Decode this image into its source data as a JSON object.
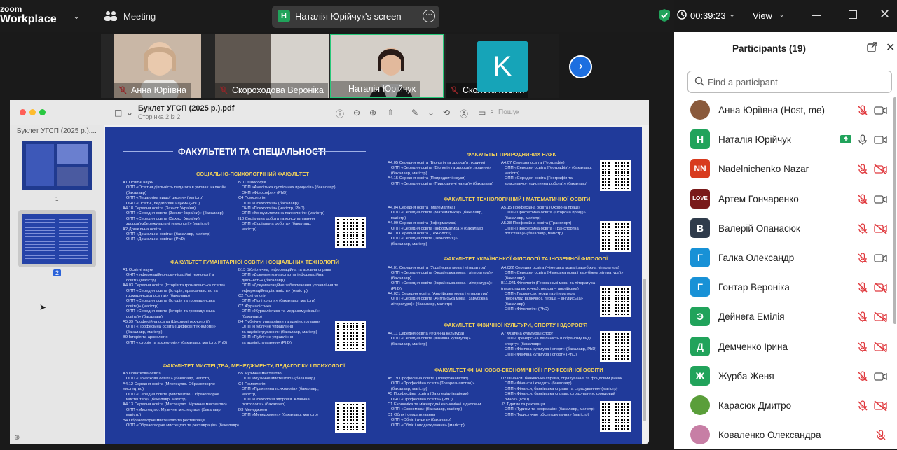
{
  "topbar": {
    "brand_line1": "zoom",
    "brand_line2": "Workplace",
    "meeting_label": "Meeting",
    "screen_badge": "Н",
    "screen_label": "Наталія Юрійчук's screen",
    "timer": "00:39:23",
    "view_label": "View"
  },
  "gallery": {
    "tiles": [
      {
        "name": "Анна Юріївна"
      },
      {
        "name": "Скороходова Вероніка"
      },
      {
        "name": "Наталія Юрійчук"
      },
      {
        "name": "Сколота Ксенія",
        "avatar_letter": "K"
      }
    ]
  },
  "pdf": {
    "title": "Буклет УГСП (2025 р.).pdf",
    "subtitle": "Сторінка 2 із 2",
    "search_placeholder": "Пошук",
    "sidebar_title": "Буклет УГСП (2025 р.)....",
    "thumb_labels": [
      "1",
      "2"
    ],
    "page": {
      "heading": "ФАКУЛЬТЕТИ ТА СПЕЦІАЛЬНОСТІ",
      "left": [
        {
          "title": "СОЦІАЛЬНО-ПСИХОЛОГІЧНИЙ ФАКУЛЬТЕТ",
          "col1": "A1 Освітні науки\n   ОПП «Освітня діяльність педагога в умовах інклюзії»\n   (бакалавр)\n   ОПП «Педагогіка вищої школи» (магістр)\n   ОНП «Освітні, педагогічні науки» (PhD)\nA4.18 Середня освіта (Захист України)\n   ОПП «Середня освіта (Захист України)» (бакалавр)\n   ОПП «Середня освіта (Захист України),\n   здоров'язбережувальні технології» (магістр)\nA2 Дошкільна освіта\n   ОПП «Дошкільна освіта» (бакалавр, магістр)\n   ОНП «Дошкільна освіта» (PhD)",
          "col2": "B10 Філософія\n   ОПП «Аналітика суспільних процесів» (бакалавр)\n   ОНП «Філософія» (PhD)\nC4 Психологія\n   ОПП «Психологія» (бакалавр)\n   ОНП «Психологія» (магістр, PhD)\n   ОПП «Консультативна психологія» (магістр)\nI10 Соціальна робота та консультування\n   ОПП «Соціальна робота» (бакалавр,\n   магістр)"
        },
        {
          "title": "ФАКУЛЬТЕТ ГУМАНІТАРНОЇ ОСВІТИ І СОЦІАЛЬНИХ ТЕХНОЛОГІЙ",
          "col1": "A1 Освітні науки\n   ОНП «Інформаційно-комунікаційні технології в\n   освіті» (магістр)\nA4.03 Середня освіта (Історія та громадянська освіта)\n   ОПП «Середня освіта (Історія, правознавство та\n   громадянська освіта)» (бакалавр)\n   ОПП «Середня освіта (Історія та громадянська\n   освіта)» (магістр)\n   ОПП «Середня освіта (Історія та громадянська\n   освіта)» (бакалавр)\nA5.39 Професійна освіта (Цифрові технології)\n   ОПП «Професійна освіта (Цифрові технології)»\n   (бакалавр, магістр)\nB9 Історія та археологія\n   ОПП «Історія та археологія» (бакалавр, магістр, PhD)",
          "col2": "B13 Бібліотечна, інформаційна та архівна справа\n   ОПП «Документознавство та інформаційна\n   діяльність» (бакалавр)\n   ОПП «Документаційне забезпечення управління та\n   інформаційна діяльність» (магістр)\nC2 Політологія\n   ОПП «Політологія» (бакалавр, магістр)\nC7 Журналістика\n   ОПП «Журналістика та медіакомунікації»\n   (бакалавр)\nD4 Публічне управління та адміністрування\n   ОПП «Публічне управління\n   та адміністрування» (бакалавр, магістр)\n   ОНП «Публічне управління\n   та адміністрування» (PhD)"
        },
        {
          "title": "ФАКУЛЬТЕТ МИСТЕЦТВА, МЕНЕДЖМЕНТУ, ПЕДАГОГІКИ І ПСИХОЛОГІЇ",
          "col1": "A3 Початкова освіта\n   ОПП «Початкова освіта» (бакалавр, магістр)\nA4.12 Середня освіта (Мистецтво. Образотворче\nмистецтво)\n   ОПП «Середня освіта (Мистецтво. Образотворче\n   мистецтво)» (бакалавр, магістр)\nA4.13 Середня освіта (Мистецтво. Музичне мистецтво)\n   ОПП «Мистецтво. Музичне мистецтво» (бакалавр,\n   магістр)\nB4 Образотворче мистецтво та реставрація\n   ОПП «Образотворче мистецтво та реставрація» (бакалавр)",
          "col2": "B5 Музичне мистецтво\n   ОПП «Музичне мистецтво» (бакалавр)\nC4 Психологія\n   ОПП «Практична психологія» (бакалавр,\n   магістр)\n   ОПП «Психологія здоров'я. Клінічна\n   психологія» (бакалавр)\nD3 Менеджмент\n   ОПП «Менеджмент» (бакалавр, магістр)"
        }
      ],
      "right": [
        {
          "title": "ФАКУЛЬТЕТ ПРИРОДНИЧИХ НАУК",
          "col1": "A4.05 Середня освіта (Біологія та здоров'я людини)\n   ОПП «Середня освіта (Біологія та здоров'я людини)»\n   (бакалавр, магістр)\nA4.15 Середня освіта (Природничі науки)\n   ОПП «Середня освіта (Природничі науки)» (бакалавр)",
          "col2": "A4.07 Середня освіта (Географія)\n   ОПП «Середня освіта (Географія)» (бакалавр,\n   магістр)\n   ОПП «Середня освіта (Географія та\n   краєзнавчо-туристична робота)» (бакалавр)"
        },
        {
          "title": "ФАКУЛЬТЕТ ТЕХНОЛОГІЧНИЙ І МАТЕМАТИЧНОЇ ОСВІТИ",
          "col1": "A4.04 Середня освіта (Математика)\n   ОПП «Середня освіта (Математика)» (бакалавр,\n   магістр)\nA4.09 Середня освіта (Інформатика)\n   ОПП «Середня освіта (Інформатика)» (бакалавр)\nA4.10 Середня освіта (Технології)\n   ОПП «Середня освіта (Технології)»\n   (бакалавр, магістр)",
          "col2": "A5.15 Професійна освіта (Охорона праці)\n   ОПП «Професійна освіта (Охорона праці)»\n   (бакалавр, магістр)\nA5.38 Професійна освіта (Транспорт)\n   ОПП «Професійна освіта (Транспортна\n   логістика)» (бакалавр, магістр)"
        },
        {
          "title": "ФАКУЛЬТЕТ УКРАЇНСЬКОЇ ФІЛОЛОГІЇ ТА ІНОЗЕМНОЇ ФІЛОЛОГІЇ",
          "col1": "A4.01 Середня освіта (Українська мова і література)\n   ОПП «Середня освіта (Українська мова і література)»\n   (бакалавр)\n   ОПП «Середня освіта (Українська мова і література)»\n   (PhD)\nA4.021 Середня освіта (Англійська мова і література)\n   ОПП «Середня освіта (Англійська мова і зарубіжна\n   література)» (бакалавр, магістр)",
          "col2": "A4.022 Середня освіта (Німецька мова і зарубіжна література)\n   ОПП «Середня освіта (Німецька мова і зарубіжна література)»\n   (бакалавр)\nB11.041 Філологія (Германські мови та література\n(переклад включно), перша – англійська)\n   ОПП «Германські мови та література\n   (переклад включно), перша – англійська»\n   (бакалавр)\n   ОНП «Філологія» (PhD)"
        },
        {
          "title": "ФАКУЛЬТЕТ ФІЗИЧНОЇ КУЛЬТУРИ, СПОРТУ І ЗДОРОВ'Я",
          "col1": "A4.11 Середня освіта (Фізична культура)\n   ОПП «Середня освіта (Фізична культура)»\n   (бакалавр, магістр)",
          "col2": "A7 Фізична культура і спорт\n   ОПП «Тренерська діяльність в обраному виді\n   спорту» (бакалавр)\n   ОПП «Фізична культура і спорт» (бакалавр, PhD)\n   ОПП «Фізична культура і спорт» (PhD)"
        },
        {
          "title": "ФАКУЛЬТЕТ ФІНАНСОВО-ЕКОНОМІЧНОЇ І ПРОФЕСІЙНОЇ ОСВІТИ",
          "col1": "A5.19 Професійна освіта (Товарознавство)\n   ОПП «Професійна освіта (Товарознавство)»\n   (бакалавр, магістр)\nA5 Професійна освіта (За спеціалізаціями)\n   ОНП «Професійна освіта» (PhD)\nC1 Економіка та міжнародні економічні відносини\n   ОПП «Економіка» (бакалавр, магістр)\nD1 Облік і оподаткування\n   ОПП «Облік і аудит» (бакалавр)\n   ОПП «Облік і оподаткування» (магістр)",
          "col2": "D2 Фінанси, банківська справа, страхування та фондовий ринок\n   ОПП «Фінанси і кредит» (бакалавр)\n   ОПП «Фінанси, банківська справа та страхування» (магістр)\n   ОНП «Фінанси, банківська справа, страхування, фондовий\n   ринок» (PhD)\nJ3 Туризм та рекреація\n   ОПП «Туризм та рекреація» (бакалавр, магістр)\n   ОПП «Туристичне обслуговування» (магістр)"
        }
      ]
    }
  },
  "participants": {
    "title": "Participants (19)",
    "search_placeholder": "Find a participant",
    "list": [
      {
        "name": "Анна Юріївна (Host, me)",
        "avatar": "",
        "color": "#8a5a3c",
        "photo": true,
        "mic": "muted",
        "cam": "on"
      },
      {
        "name": "Наталія Юрійчук",
        "avatar": "Н",
        "color": "#21a35b",
        "mic": "on",
        "cam": "on",
        "sharing": true
      },
      {
        "name": "Nadelnichenko Nazar",
        "avatar": "NN",
        "color": "#d83b1e",
        "mic": "muted",
        "cam": "off"
      },
      {
        "name": "Артем Гончаренко",
        "avatar": "LOVE",
        "color": "#7a1a1a",
        "mic": "muted",
        "cam": "on"
      },
      {
        "name": "Валерій Опанасюк",
        "avatar": "В",
        "color": "#2f3b4b",
        "mic": "muted",
        "cam": "off"
      },
      {
        "name": "Галка Олександр",
        "avatar": "Г",
        "color": "#1891d6",
        "mic": "muted",
        "cam": "on"
      },
      {
        "name": "Гонтар Вероніка",
        "avatar": "Г",
        "color": "#1891d6",
        "mic": "muted",
        "cam": "off"
      },
      {
        "name": "Дейнега Емілія",
        "avatar": "Э",
        "color": "#21a35b",
        "mic": "muted",
        "cam": "off"
      },
      {
        "name": "Демченко Ірина",
        "avatar": "Д",
        "color": "#21a35b",
        "mic": "muted",
        "cam": "off"
      },
      {
        "name": "Журба Женя",
        "avatar": "Ж",
        "color": "#21a35b",
        "mic": "muted",
        "cam": "on"
      },
      {
        "name": "Карасюк Дмитро",
        "avatar": "",
        "color": "#5a9e3a",
        "photo": true,
        "mic": "muted",
        "cam": "off"
      },
      {
        "name": "Коваленко Олександра",
        "avatar": "",
        "color": "#c77ea5",
        "photo": true,
        "mic": "muted",
        "cam": "none"
      }
    ]
  },
  "colors": {
    "accent_green": "#21a35b",
    "muted_red": "#e0393e",
    "brand_blue": "#1d6fe0",
    "page_blue": "#203a9a"
  }
}
